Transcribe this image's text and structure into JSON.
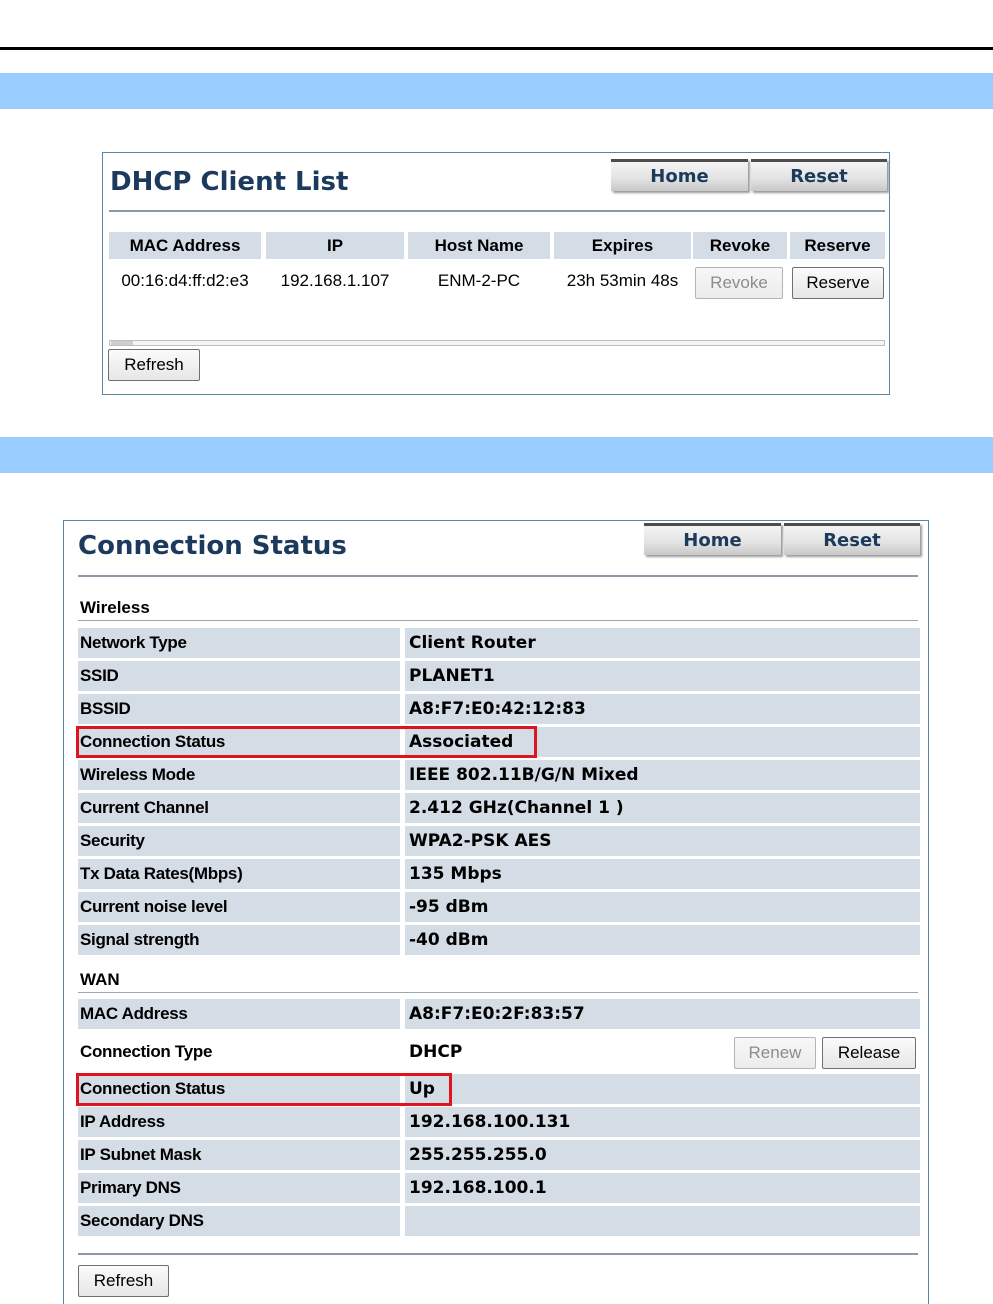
{
  "dhcp": {
    "title": "DHCP Client List",
    "home_label": "Home",
    "reset_label": "Reset",
    "columns": [
      "MAC Address",
      "IP",
      "Host Name",
      "Expires",
      "Revoke",
      "Reserve"
    ],
    "rows": [
      {
        "mac": "00:16:d4:ff:d2:e3",
        "ip": "192.168.1.107",
        "host": "ENM-2-PC",
        "expires": "23h 53min 48s",
        "revoke_label": "Revoke",
        "reserve_label": "Reserve"
      }
    ],
    "refresh_label": "Refresh"
  },
  "status": {
    "title": "Connection Status",
    "home_label": "Home",
    "reset_label": "Reset",
    "wireless_label": "Wireless",
    "wireless": [
      {
        "label": "Network Type",
        "value": "Client Router"
      },
      {
        "label": "SSID",
        "value": "PLANET1"
      },
      {
        "label": "BSSID",
        "value": "A8:F7:E0:42:12:83"
      },
      {
        "label": "Connection Status",
        "value": "Associated"
      },
      {
        "label": "Wireless Mode",
        "value": "IEEE 802.11B/G/N Mixed"
      },
      {
        "label": "Current Channel",
        "value": "2.412 GHz(Channel 1 )"
      },
      {
        "label": "Security",
        "value": "WPA2-PSK AES"
      },
      {
        "label": "Tx Data Rates(Mbps)",
        "value": "135 Mbps"
      },
      {
        "label": "Current noise level",
        "value": "-95 dBm"
      },
      {
        "label": "Signal strength",
        "value": "-40 dBm"
      }
    ],
    "wan_label": "WAN",
    "wan": [
      {
        "label": "MAC Address",
        "value": "A8:F7:E0:2F:83:57"
      },
      {
        "label": "Connection Type",
        "value": "DHCP"
      },
      {
        "label": "Connection Status",
        "value": "Up"
      },
      {
        "label": "IP Address",
        "value": "192.168.100.131"
      },
      {
        "label": "IP Subnet Mask",
        "value": "255.255.255.0"
      },
      {
        "label": "Primary DNS",
        "value": "192.168.100.1"
      },
      {
        "label": "Secondary DNS",
        "value": ""
      }
    ],
    "renew_label": "Renew",
    "release_label": "Release",
    "refresh_label": "Refresh"
  },
  "colors": {
    "band": "#99ccff",
    "row_bg": "#d4dde6",
    "title_text": "#1b3a5c",
    "highlight": "#e0141e"
  }
}
